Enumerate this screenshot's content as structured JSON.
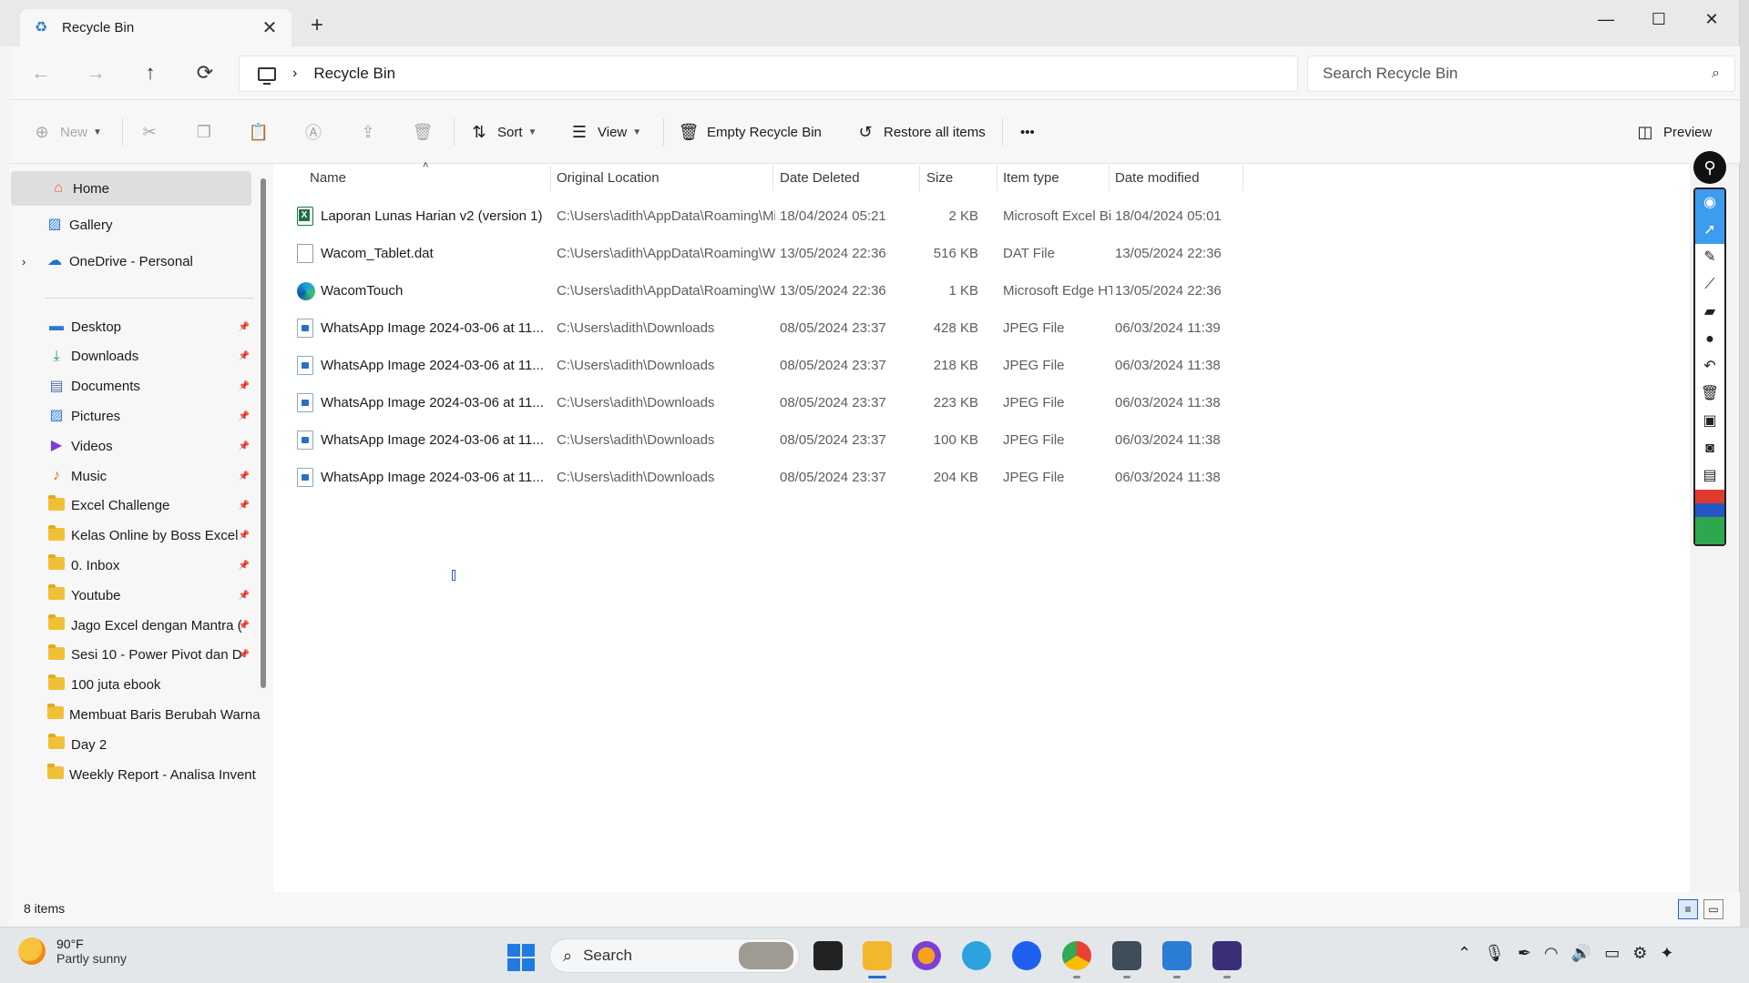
{
  "window": {
    "tab_title": "Recycle Bin",
    "tab_close": "✕",
    "new_tab": "+",
    "minimize": "—",
    "maximize": "☐",
    "close": "✕"
  },
  "address": {
    "crumb": "Recycle Bin",
    "search_placeholder": "Search Recycle Bin"
  },
  "commands": {
    "new": "New",
    "sort": "Sort",
    "view": "View",
    "empty": "Empty Recycle Bin",
    "restore_all": "Restore all items",
    "more": "•••",
    "preview": "Preview"
  },
  "sidebar": {
    "home": "Home",
    "gallery": "Gallery",
    "onedrive": "OneDrive - Personal",
    "pinned": [
      {
        "label": "Desktop",
        "icon": "desktop-icon"
      },
      {
        "label": "Downloads",
        "icon": "download-icon"
      },
      {
        "label": "Documents",
        "icon": "documents-icon"
      },
      {
        "label": "Pictures",
        "icon": "pictures-icon"
      },
      {
        "label": "Videos",
        "icon": "videos-icon"
      },
      {
        "label": "Music",
        "icon": "music-icon"
      },
      {
        "label": "Excel Challenge",
        "icon": "folder-icon"
      },
      {
        "label": "Kelas Online by Boss Excel",
        "icon": "folder-icon"
      },
      {
        "label": "0. Inbox",
        "icon": "folder-icon"
      },
      {
        "label": "Youtube",
        "icon": "folder-icon"
      },
      {
        "label": "Jago Excel dengan Mantra (",
        "icon": "folder-icon"
      },
      {
        "label": "Sesi 10 - Power Pivot dan D",
        "icon": "folder-icon"
      },
      {
        "label": "100 juta ebook",
        "icon": "folder-icon"
      },
      {
        "label": "Membuat Baris Berubah Warna",
        "icon": "folder-icon"
      },
      {
        "label": "Day 2",
        "icon": "folder-icon"
      },
      {
        "label": "Weekly Report - Analisa Invent",
        "icon": "folder-icon"
      }
    ]
  },
  "columns": [
    "Name",
    "Original Location",
    "Date Deleted",
    "Size",
    "Item type",
    "Date modified"
  ],
  "files": [
    {
      "name": "Laporan Lunas Harian v2 (version 1)",
      "location": "C:\\Users\\adith\\AppData\\Roaming\\Micro...",
      "deleted": "18/04/2024 05:21",
      "size": "2 KB",
      "type": "Microsoft Excel Bi...",
      "modified": "18/04/2024 05:01",
      "icon": "xls"
    },
    {
      "name": "Wacom_Tablet.dat",
      "location": "C:\\Users\\adith\\AppData\\Roaming\\WTabl...",
      "deleted": "13/05/2024 22:36",
      "size": "516 KB",
      "type": "DAT File",
      "modified": "13/05/2024 22:36",
      "icon": "doc"
    },
    {
      "name": "WacomTouch",
      "location": "C:\\Users\\adith\\AppData\\Roaming\\WTabl...",
      "deleted": "13/05/2024 22:36",
      "size": "1 KB",
      "type": "Microsoft Edge HT...",
      "modified": "13/05/2024 22:36",
      "icon": "edge"
    },
    {
      "name": "WhatsApp Image 2024-03-06 at 11...",
      "location": "C:\\Users\\adith\\Downloads",
      "deleted": "08/05/2024 23:37",
      "size": "428 KB",
      "type": "JPEG File",
      "modified": "06/03/2024 11:39",
      "icon": "img"
    },
    {
      "name": "WhatsApp Image 2024-03-06 at 11...",
      "location": "C:\\Users\\adith\\Downloads",
      "deleted": "08/05/2024 23:37",
      "size": "218 KB",
      "type": "JPEG File",
      "modified": "06/03/2024 11:38",
      "icon": "img"
    },
    {
      "name": "WhatsApp Image 2024-03-06 at 11...",
      "location": "C:\\Users\\adith\\Downloads",
      "deleted": "08/05/2024 23:37",
      "size": "223 KB",
      "type": "JPEG File",
      "modified": "06/03/2024 11:38",
      "icon": "img"
    },
    {
      "name": "WhatsApp Image 2024-03-06 at 11...",
      "location": "C:\\Users\\adith\\Downloads",
      "deleted": "08/05/2024 23:37",
      "size": "100 KB",
      "type": "JPEG File",
      "modified": "06/03/2024 11:38",
      "icon": "img"
    },
    {
      "name": "WhatsApp Image 2024-03-06 at 11...",
      "location": "C:\\Users\\adith\\Downloads",
      "deleted": "08/05/2024 23:37",
      "size": "204 KB",
      "type": "JPEG File",
      "modified": "06/03/2024 11:38",
      "icon": "img"
    }
  ],
  "status": {
    "count": "8 items"
  },
  "taskbar": {
    "temp": "90°F",
    "condition": "Partly sunny",
    "search_placeholder": "Search"
  },
  "colors": {
    "accent": "#1f6fd6",
    "selection": "#dedede",
    "excel": "#1e7145"
  }
}
